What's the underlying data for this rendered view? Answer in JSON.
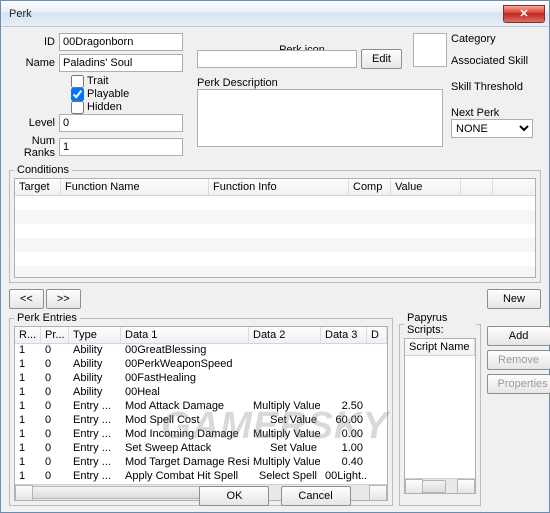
{
  "window": {
    "title": "Perk"
  },
  "labels": {
    "id": "ID",
    "name": "Name",
    "trait": "Trait",
    "playable": "Playable",
    "hidden": "Hidden",
    "level": "Level",
    "numranks": "Num Ranks",
    "perkicon": "Perk icon",
    "edit": "Edit",
    "perkdesc": "Perk Description",
    "category": "Category",
    "assocskill": "Associated Skill",
    "skillthresh": "Skill Threshold",
    "nextperk": "Next Perk",
    "conditions": "Conditions",
    "perkentries": "Perk Entries",
    "papyrus": "Papyrus Scripts:",
    "new": "New",
    "add": "Add",
    "remove": "Remove",
    "properties": "Properties",
    "ok": "OK",
    "cancel": "Cancel",
    "prev": "<<",
    "next": ">>"
  },
  "fields": {
    "id": "00Dragonborn",
    "name": "Paladins' Soul",
    "trait": false,
    "playable": true,
    "hidden": false,
    "level": "0",
    "numranks": "1",
    "perkicon": "",
    "perkdesc": "",
    "nextperk": "NONE"
  },
  "cond_cols": [
    "Target",
    "Function Name",
    "Function Info",
    "Comp",
    "Value",
    ""
  ],
  "entry_cols": [
    "R...",
    "Pr...",
    "Type",
    "Data 1",
    "Data 2",
    "Data 3",
    "D"
  ],
  "entries": [
    {
      "r": "1",
      "p": "0",
      "type": "Ability",
      "d1": "00GreatBlessing",
      "d2": "",
      "d3": ""
    },
    {
      "r": "1",
      "p": "0",
      "type": "Ability",
      "d1": "00PerkWeaponSpeed",
      "d2": "",
      "d3": ""
    },
    {
      "r": "1",
      "p": "0",
      "type": "Ability",
      "d1": "00FastHealing",
      "d2": "",
      "d3": ""
    },
    {
      "r": "1",
      "p": "0",
      "type": "Ability",
      "d1": "00Heal",
      "d2": "",
      "d3": ""
    },
    {
      "r": "1",
      "p": "0",
      "type": "Entry ...",
      "d1": "Mod Attack Damage",
      "d2": "Multiply Value",
      "d3": "2.50"
    },
    {
      "r": "1",
      "p": "0",
      "type": "Entry ...",
      "d1": "Mod Spell Cost",
      "d2": "Set Value",
      "d3": "60.00"
    },
    {
      "r": "1",
      "p": "0",
      "type": "Entry ...",
      "d1": "Mod Incoming Damage",
      "d2": "Multiply Value",
      "d3": "0.00"
    },
    {
      "r": "1",
      "p": "0",
      "type": "Entry ...",
      "d1": "Set Sweep Attack",
      "d2": "Set Value",
      "d3": "1.00"
    },
    {
      "r": "1",
      "p": "0",
      "type": "Entry ...",
      "d1": "Mod Target Damage Resi...",
      "d2": "Multiply Value",
      "d3": "0.40"
    },
    {
      "r": "1",
      "p": "0",
      "type": "Entry ...",
      "d1": "Apply Combat Hit Spell",
      "d2": "Select Spell",
      "d3": "00Light..."
    }
  ],
  "script_cols": [
    "Script Name"
  ],
  "watermark": "GAMERSKY"
}
